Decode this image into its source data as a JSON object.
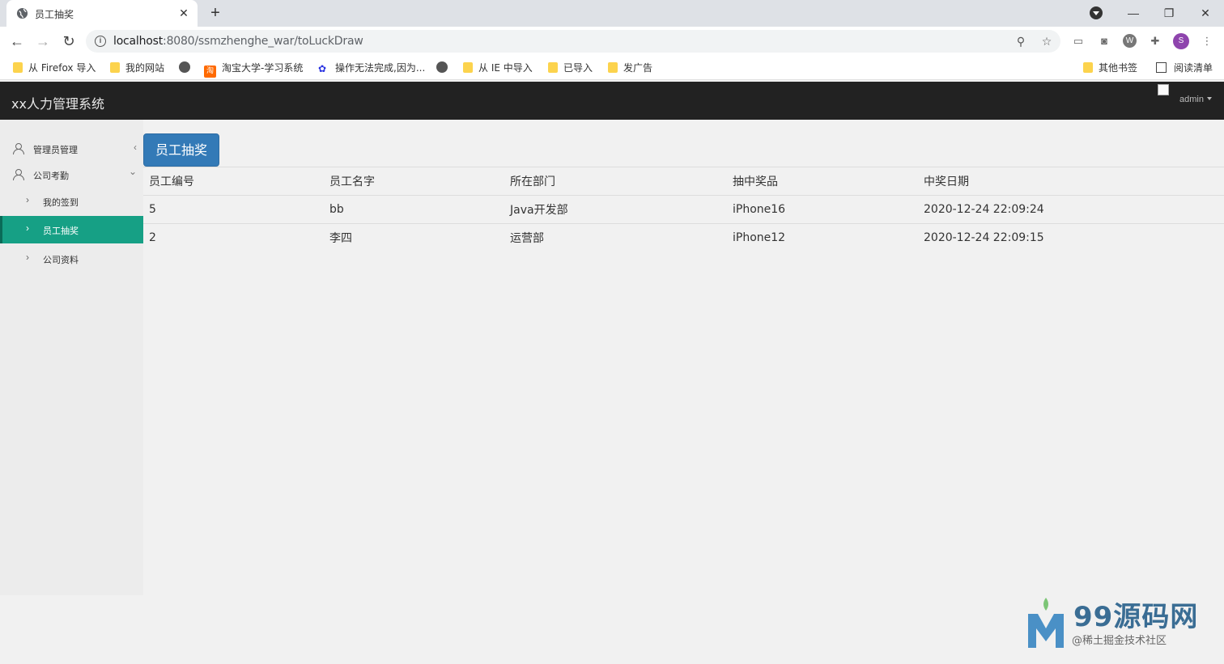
{
  "browser": {
    "tab_title": "员工抽奖",
    "url_host": "localhost",
    "url_rest": ":8080/ssmzhenghe_war/toLuckDraw",
    "profile_initial": "S",
    "bookmarks": [
      {
        "label": "从 Firefox 导入",
        "icon": "folder-icon"
      },
      {
        "label": "我的网站",
        "icon": "folder-icon"
      },
      {
        "label": "",
        "icon": "globe-icon"
      },
      {
        "label": "淘宝大学-学习系统",
        "icon": "taobao-icon"
      },
      {
        "label": "操作无法完成,因为...",
        "icon": "baidu-paw-icon"
      },
      {
        "label": "",
        "icon": "globe-icon"
      },
      {
        "label": "从 IE 中导入",
        "icon": "folder-icon"
      },
      {
        "label": "已导入",
        "icon": "folder-icon"
      },
      {
        "label": "发广告",
        "icon": "folder-icon"
      },
      {
        "label": "其他书签",
        "icon": "folder-icon"
      },
      {
        "label": "阅读清单",
        "icon": "reading-list-icon"
      }
    ]
  },
  "app": {
    "brand": "xx人力管理系统",
    "user": "admin",
    "sidebar": {
      "menus": [
        {
          "label": "管理员管理",
          "icon": "user-icon",
          "expanded": false
        },
        {
          "label": "公司考勤",
          "icon": "user-icon",
          "expanded": true
        }
      ],
      "sub_items": [
        {
          "label": "我的签到",
          "active": false
        },
        {
          "label": "员工抽奖",
          "active": true
        },
        {
          "label": "公司资料",
          "active": false
        }
      ]
    },
    "panel_button": "员工抽奖",
    "table": {
      "headers": [
        "员工编号",
        "员工名字",
        "所在部门",
        "抽中奖品",
        "中奖日期"
      ],
      "rows": [
        [
          "5",
          "bb",
          "Java开发部",
          "iPhone16",
          "2020-12-24 22:09:24"
        ],
        [
          "2",
          "李四",
          "运营部",
          "iPhone12",
          "2020-12-24 22:09:15"
        ]
      ]
    }
  },
  "watermark": {
    "title": "99源码网",
    "subtitle": "@稀土掘金技术社区"
  },
  "colors": {
    "header_bg": "#222222",
    "active_menu": "#16a085",
    "primary_button": "#337ab7"
  }
}
